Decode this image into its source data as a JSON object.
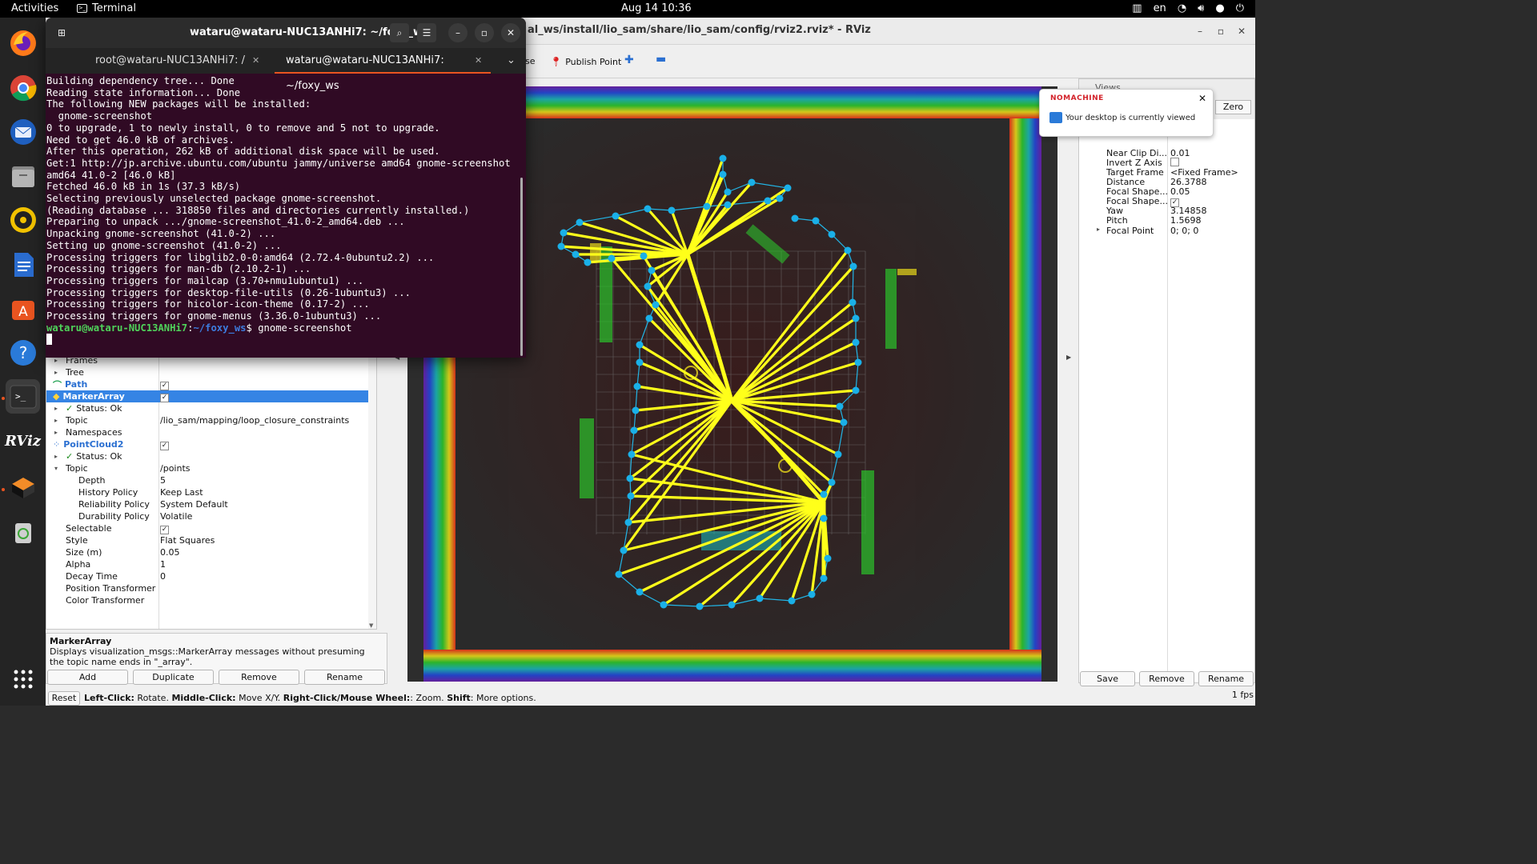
{
  "topbar": {
    "activities": "Activities",
    "app_name": "Terminal",
    "clock": "Aug 14  10:36",
    "lang": "en"
  },
  "dock": {
    "items": [
      "firefox-icon",
      "chrome-icon",
      "thunderbird-icon",
      "files-icon",
      "rhythmbox-icon",
      "writer-icon",
      "software-icon",
      "help-icon",
      "terminal-icon",
      "rviz-icon",
      "nomachine-icon",
      "trash-icon",
      "app-grid-icon"
    ],
    "active": "terminal-icon",
    "rviz_label": "RViz"
  },
  "rviz": {
    "title": "al_ws/install/lio_sam/share/lio_sam/config/rviz2.rviz* - RViz",
    "toolbar": {
      "partial_label": "se",
      "publish_point": "Publish Point"
    },
    "displays": {
      "rows": [
        {
          "name": "Frames",
          "value": ""
        },
        {
          "name": "Tree",
          "value": ""
        },
        {
          "name": "Path",
          "value": ""
        },
        {
          "name": "MarkerArray",
          "value": ""
        },
        {
          "name": "Status: Ok",
          "value": ""
        },
        {
          "name": "Topic",
          "value": "/lio_sam/mapping/loop_closure_constraints"
        },
        {
          "name": "Namespaces",
          "value": ""
        },
        {
          "name": "PointCloud2",
          "value": ""
        },
        {
          "name": "Status: Ok",
          "value": ""
        },
        {
          "name": "Topic",
          "value": "/points"
        },
        {
          "name": "Depth",
          "value": "5"
        },
        {
          "name": "History Policy",
          "value": "Keep Last"
        },
        {
          "name": "Reliability Policy",
          "value": "System Default"
        },
        {
          "name": "Durability Policy",
          "value": "Volatile"
        },
        {
          "name": "Selectable",
          "value": ""
        },
        {
          "name": "Style",
          "value": "Flat Squares"
        },
        {
          "name": "Size (m)",
          "value": "0.05"
        },
        {
          "name": "Alpha",
          "value": "1"
        },
        {
          "name": "Decay Time",
          "value": "0"
        },
        {
          "name": "Position Transformer",
          "value": ""
        },
        {
          "name": "Color Transformer",
          "value": ""
        }
      ],
      "selected": "MarkerArray"
    },
    "description": {
      "title": "MarkerArray",
      "text": "Displays visualization_msgs::MarkerArray messages without presuming the topic name ends in \"_array\"."
    },
    "buttons": {
      "add": "Add",
      "duplicate": "Duplicate",
      "remove": "Remove",
      "rename": "Rename"
    },
    "views": {
      "header": "Views",
      "zero": "Zero",
      "rows": [
        {
          "k": "Near Clip Di...",
          "v": "0.01"
        },
        {
          "k": "Invert Z Axis",
          "v": ""
        },
        {
          "k": "Target Frame",
          "v": "<Fixed Frame>"
        },
        {
          "k": "Distance",
          "v": "26.3788"
        },
        {
          "k": "Focal Shape...",
          "v": "0.05"
        },
        {
          "k": "Focal Shape...",
          "v": ""
        },
        {
          "k": "Yaw",
          "v": "3.14858"
        },
        {
          "k": "Pitch",
          "v": "1.5698"
        },
        {
          "k": "Focal Point",
          "v": "0; 0; 0"
        }
      ],
      "buttons": {
        "save": "Save",
        "remove": "Remove",
        "rename": "Rename"
      }
    },
    "status": {
      "reset": "Reset",
      "left_click": "Left-Click:",
      "left_click_desc": " Rotate. ",
      "middle_click": "Middle-Click:",
      "middle_click_desc": " Move X/Y. ",
      "right_click": "Right-Click/Mouse Wheel:",
      "right_click_desc": ": Zoom. ",
      "shift": "Shift",
      "shift_desc": ": More options.",
      "fps": "1 fps"
    }
  },
  "terminal": {
    "title": "wataru@wataru-NUC13ANHi7: ~/foxy_ws",
    "tabs": [
      "root@wataru-NUC13ANHi7: /",
      "wataru@wataru-NUC13ANHi7: ~/foxy_ws"
    ],
    "lines": [
      "Building dependency tree... Done",
      "Reading state information... Done",
      "The following NEW packages will be installed:",
      "  gnome-screenshot",
      "0 to upgrade, 1 to newly install, 0 to remove and 5 not to upgrade.",
      "Need to get 46.0 kB of archives.",
      "After this operation, 262 kB of additional disk space will be used.",
      "Get:1 http://jp.archive.ubuntu.com/ubuntu jammy/universe amd64 gnome-screenshot",
      "amd64 41.0-2 [46.0 kB]",
      "Fetched 46.0 kB in 1s (37.3 kB/s)",
      "Selecting previously unselected package gnome-screenshot.",
      "(Reading database ... 318850 files and directories currently installed.)",
      "Preparing to unpack .../gnome-screenshot_41.0-2_amd64.deb ...",
      "Unpacking gnome-screenshot (41.0-2) ...",
      "Setting up gnome-screenshot (41.0-2) ...",
      "Processing triggers for libglib2.0-0:amd64 (2.72.4-0ubuntu2.2) ...",
      "Processing triggers for man-db (2.10.2-1) ...",
      "Processing triggers for mailcap (3.70+nmu1ubuntu1) ...",
      "Processing triggers for desktop-file-utils (0.26-1ubuntu3) ...",
      "Processing triggers for hicolor-icon-theme (0.17-2) ...",
      "Processing triggers for gnome-menus (3.36.0-1ubuntu3) ..."
    ],
    "prompt_user": "wataru@wataru-NUC13ANHi7",
    "prompt_path": "~/foxy_ws",
    "command": "gnome-screenshot"
  },
  "toast": {
    "brand": "NOMACHINE",
    "message": "Your desktop is currently viewed"
  },
  "colors": {
    "accent": "#e95420",
    "selection": "#3584e4",
    "terminal_bg": "#300a24",
    "marker": "#ffff1a",
    "node": "#1ab0e8"
  }
}
